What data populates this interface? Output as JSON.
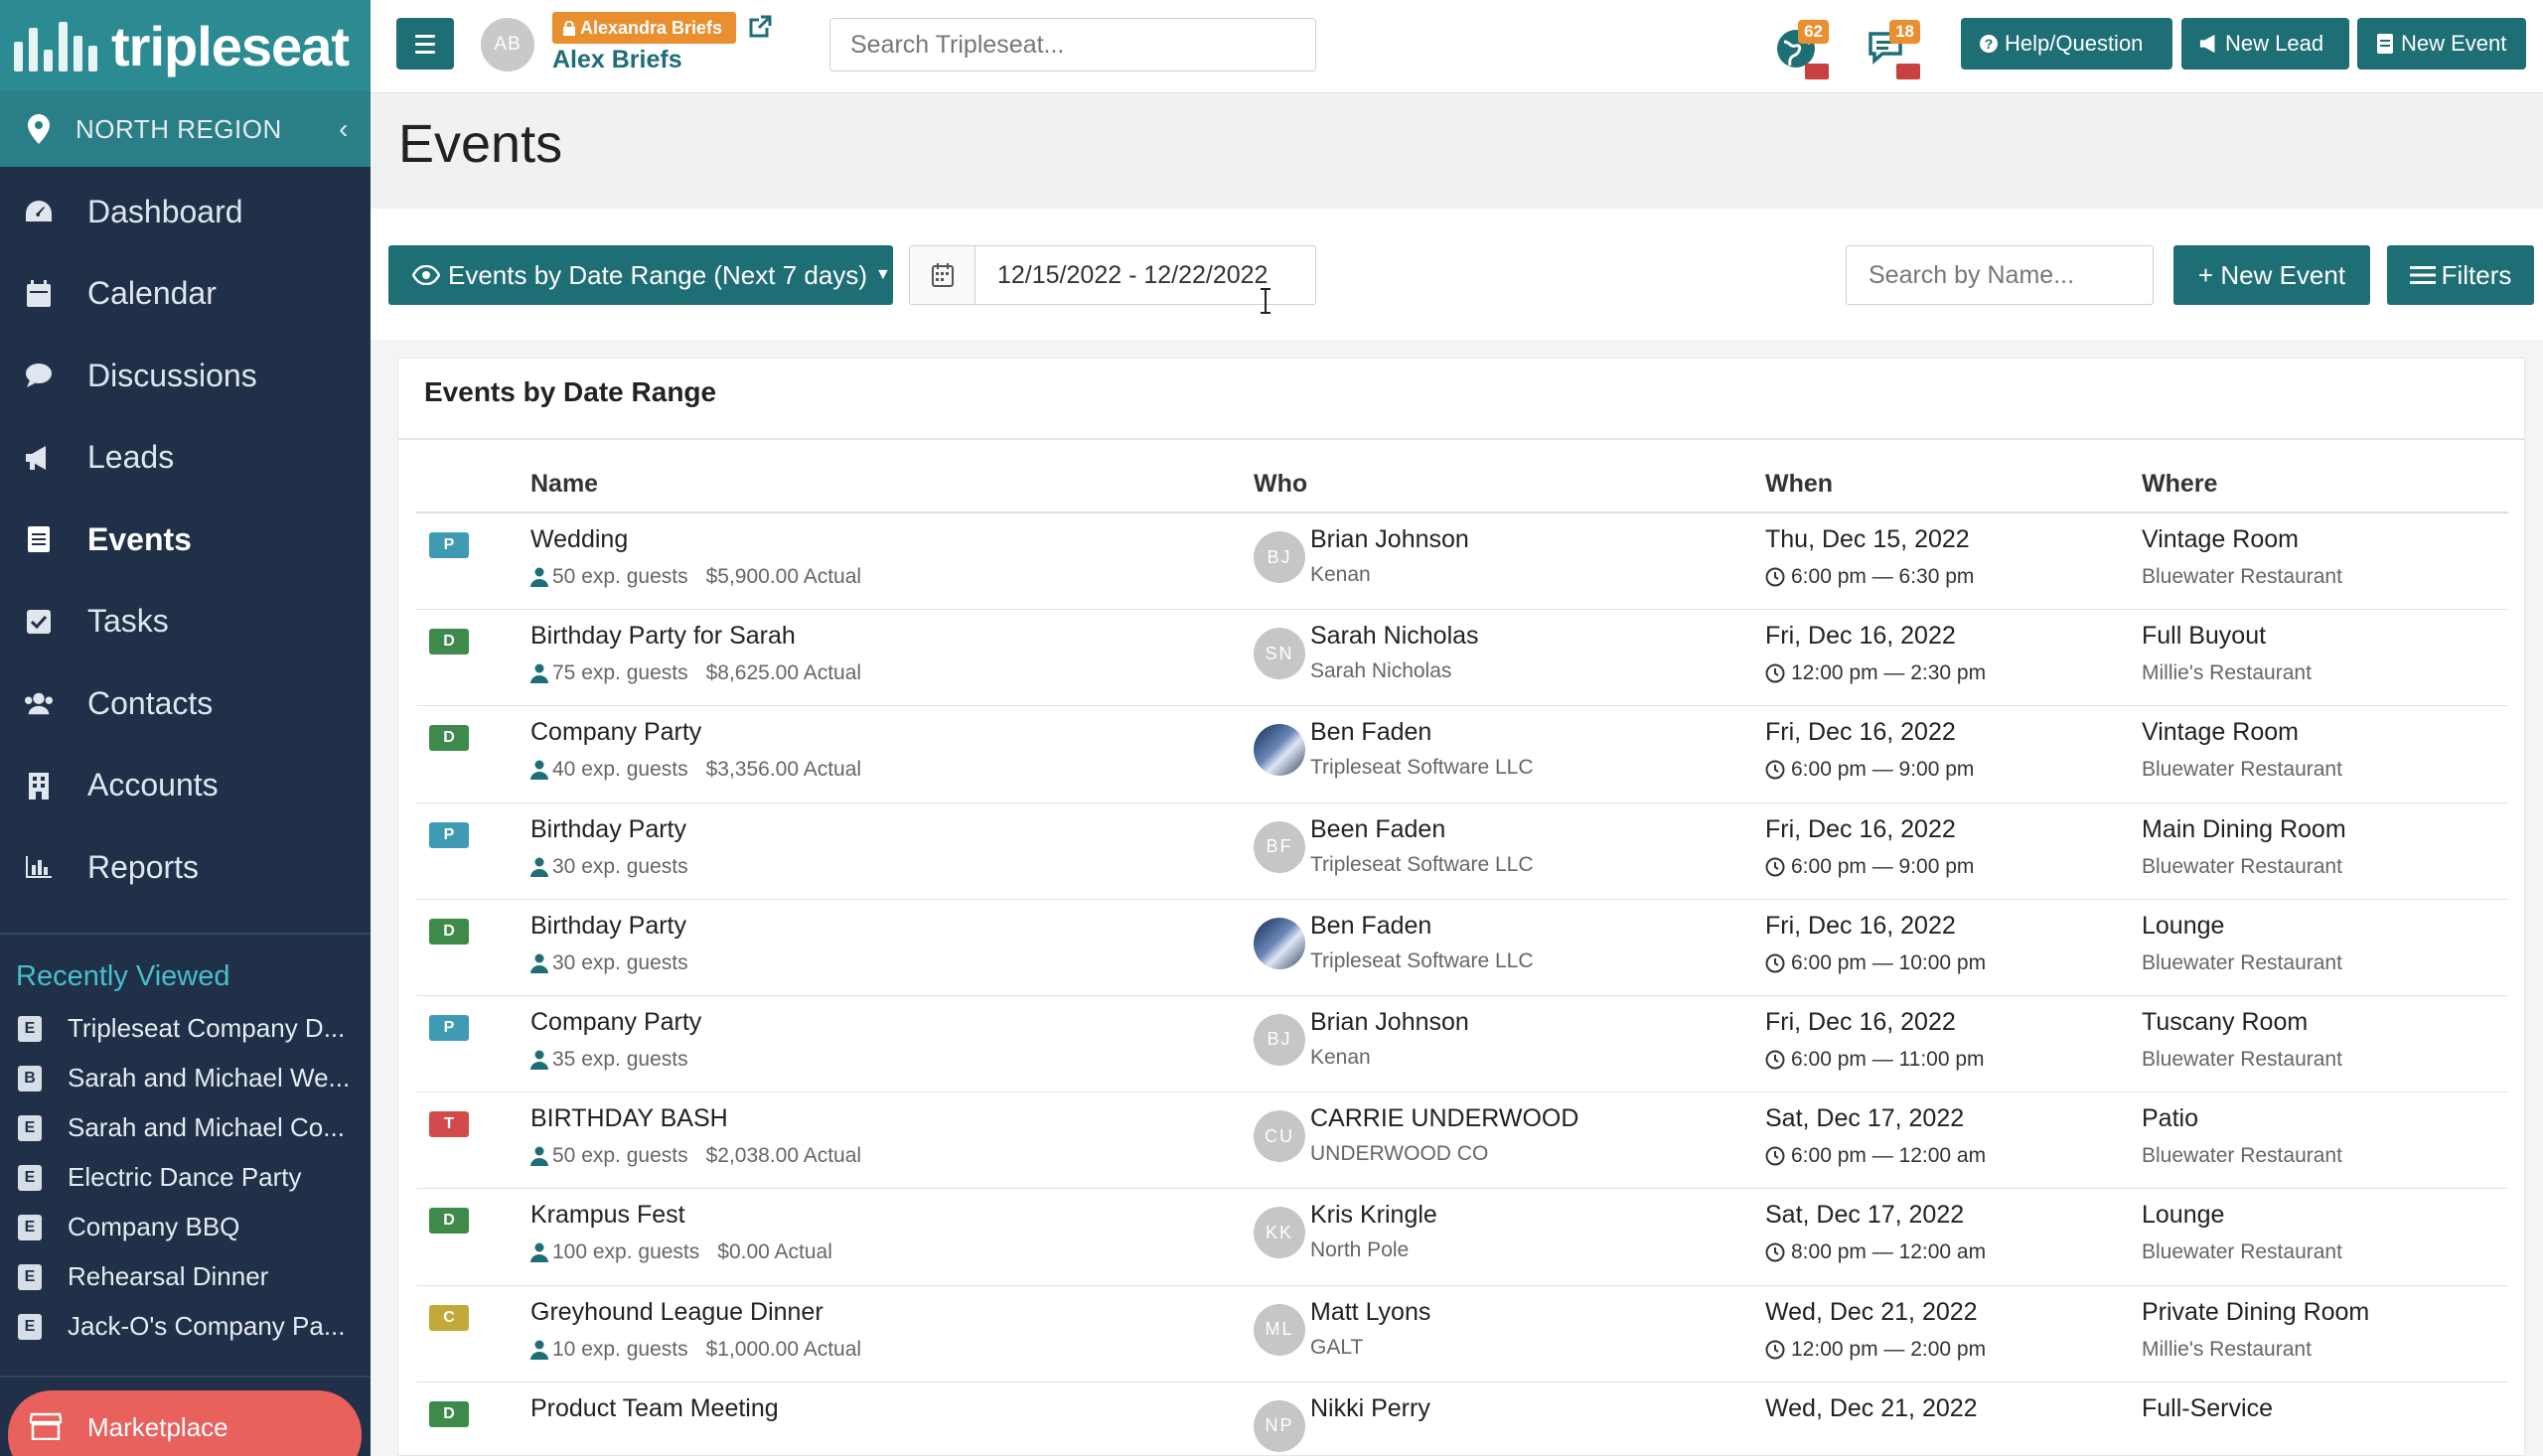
{
  "brand": {
    "name": "tripleseat"
  },
  "region": {
    "label": "NORTH REGION"
  },
  "nav": [
    {
      "label": "Dashboard",
      "icon": "dashboard-icon"
    },
    {
      "label": "Calendar",
      "icon": "calendar-icon"
    },
    {
      "label": "Discussions",
      "icon": "chat-icon"
    },
    {
      "label": "Leads",
      "icon": "bullhorn-icon"
    },
    {
      "label": "Events",
      "icon": "events-icon",
      "active": true
    },
    {
      "label": "Tasks",
      "icon": "checkbox-icon"
    },
    {
      "label": "Contacts",
      "icon": "users-icon"
    },
    {
      "label": "Accounts",
      "icon": "building-icon"
    },
    {
      "label": "Reports",
      "icon": "bar-chart-icon"
    }
  ],
  "recent": {
    "title": "Recently Viewed",
    "items": [
      {
        "badge": "E",
        "label": "Tripleseat Company D..."
      },
      {
        "badge": "B",
        "label": "Sarah and Michael We..."
      },
      {
        "badge": "E",
        "label": "Sarah and Michael Co..."
      },
      {
        "badge": "E",
        "label": "Electric Dance Party"
      },
      {
        "badge": "E",
        "label": "Company BBQ"
      },
      {
        "badge": "E",
        "label": "Rehearsal Dinner"
      },
      {
        "badge": "E",
        "label": "Jack-O's Company Pa..."
      }
    ]
  },
  "marketplace": {
    "label": "Marketplace"
  },
  "topbar": {
    "avatar_initials": "AB",
    "user_tag": "Alexandra Briefs",
    "user_name": "Alex Briefs",
    "search_placeholder": "Search Tripleseat...",
    "notif_globe_count": "62",
    "notif_chat_count": "18",
    "help_label": "Help/Question",
    "new_lead_label": "New Lead",
    "new_event_label": "New Event"
  },
  "page": {
    "title": "Events"
  },
  "toolbar": {
    "range_label": "Events by Date Range (Next 7 days)",
    "date_range": "12/15/2022 - 12/22/2022",
    "name_search_placeholder": "Search by Name...",
    "new_event_label": "+ New Event",
    "filters_label": "Filters"
  },
  "panel": {
    "title": "Events by Date Range"
  },
  "table": {
    "headers": {
      "name": "Name",
      "who": "Who",
      "when": "When",
      "where": "Where"
    },
    "status_colors": {
      "P": "#3e9bb3",
      "D": "#3d8a4a",
      "T": "#d24b4b",
      "C": "#c2a93a"
    },
    "rows": [
      {
        "status": "P",
        "name": "Wedding",
        "guests": "50 exp. guests",
        "amount": "$5,900.00 Actual",
        "initials": "BJ",
        "photo": false,
        "who": "Brian Johnson",
        "org": "Kenan",
        "date": "Thu, Dec 15, 2022",
        "time": "6:00 pm — 6:30 pm",
        "room": "Vintage Room",
        "venue": "Bluewater Restaurant"
      },
      {
        "status": "D",
        "name": "Birthday Party for Sarah",
        "guests": "75 exp. guests",
        "amount": "$8,625.00 Actual",
        "initials": "SN",
        "photo": false,
        "who": "Sarah Nicholas",
        "org": "Sarah Nicholas",
        "date": "Fri, Dec 16, 2022",
        "time": "12:00 pm — 2:30 pm",
        "room": "Full Buyout",
        "venue": "Millie's Restaurant"
      },
      {
        "status": "D",
        "name": "Company Party",
        "guests": "40 exp. guests",
        "amount": "$3,356.00 Actual",
        "initials": "",
        "photo": true,
        "who": "Ben Faden",
        "org": "Tripleseat Software LLC",
        "date": "Fri, Dec 16, 2022",
        "time": "6:00 pm — 9:00 pm",
        "room": "Vintage Room",
        "venue": "Bluewater Restaurant"
      },
      {
        "status": "P",
        "name": "Birthday Party",
        "guests": "30 exp. guests",
        "amount": "",
        "initials": "BF",
        "photo": false,
        "who": "Been Faden",
        "org": "Tripleseat Software LLC",
        "date": "Fri, Dec 16, 2022",
        "time": "6:00 pm — 9:00 pm",
        "room": "Main Dining Room",
        "venue": "Bluewater Restaurant"
      },
      {
        "status": "D",
        "name": "Birthday Party",
        "guests": "30 exp. guests",
        "amount": "",
        "initials": "",
        "photo": true,
        "who": "Ben Faden",
        "org": "Tripleseat Software LLC",
        "date": "Fri, Dec 16, 2022",
        "time": "6:00 pm — 10:00 pm",
        "room": "Lounge",
        "venue": "Bluewater Restaurant"
      },
      {
        "status": "P",
        "name": "Company Party",
        "guests": "35 exp. guests",
        "amount": "",
        "initials": "BJ",
        "photo": false,
        "who": "Brian Johnson",
        "org": "Kenan",
        "date": "Fri, Dec 16, 2022",
        "time": "6:00 pm — 11:00 pm",
        "room": "Tuscany Room",
        "venue": "Bluewater Restaurant"
      },
      {
        "status": "T",
        "name": "BIRTHDAY BASH",
        "guests": "50 exp. guests",
        "amount": "$2,038.00 Actual",
        "initials": "CU",
        "photo": false,
        "who": "CARRIE UNDERWOOD",
        "org": "UNDERWOOD CO",
        "date": "Sat, Dec 17, 2022",
        "time": "6:00 pm — 12:00 am",
        "room": "Patio",
        "venue": "Bluewater Restaurant"
      },
      {
        "status": "D",
        "name": "Krampus Fest",
        "guests": "100 exp. guests",
        "amount": "$0.00 Actual",
        "initials": "KK",
        "photo": false,
        "who": "Kris Kringle",
        "org": "North Pole",
        "date": "Sat, Dec 17, 2022",
        "time": "8:00 pm — 12:00 am",
        "room": "Lounge",
        "venue": "Bluewater Restaurant"
      },
      {
        "status": "C",
        "name": "Greyhound League Dinner",
        "guests": "10 exp. guests",
        "amount": "$1,000.00 Actual",
        "initials": "ML",
        "photo": false,
        "who": "Matt Lyons",
        "org": "GALT",
        "date": "Wed, Dec 21, 2022",
        "time": "12:00 pm — 2:00 pm",
        "room": "Private Dining Room",
        "venue": "Millie's Restaurant"
      },
      {
        "status": "D",
        "name": "Product Team Meeting",
        "guests": "",
        "amount": "",
        "initials": "NP",
        "photo": false,
        "who": "Nikki Perry",
        "org": "",
        "date": "Wed, Dec 21, 2022",
        "time": "",
        "room": "Full-Service",
        "venue": ""
      }
    ]
  }
}
